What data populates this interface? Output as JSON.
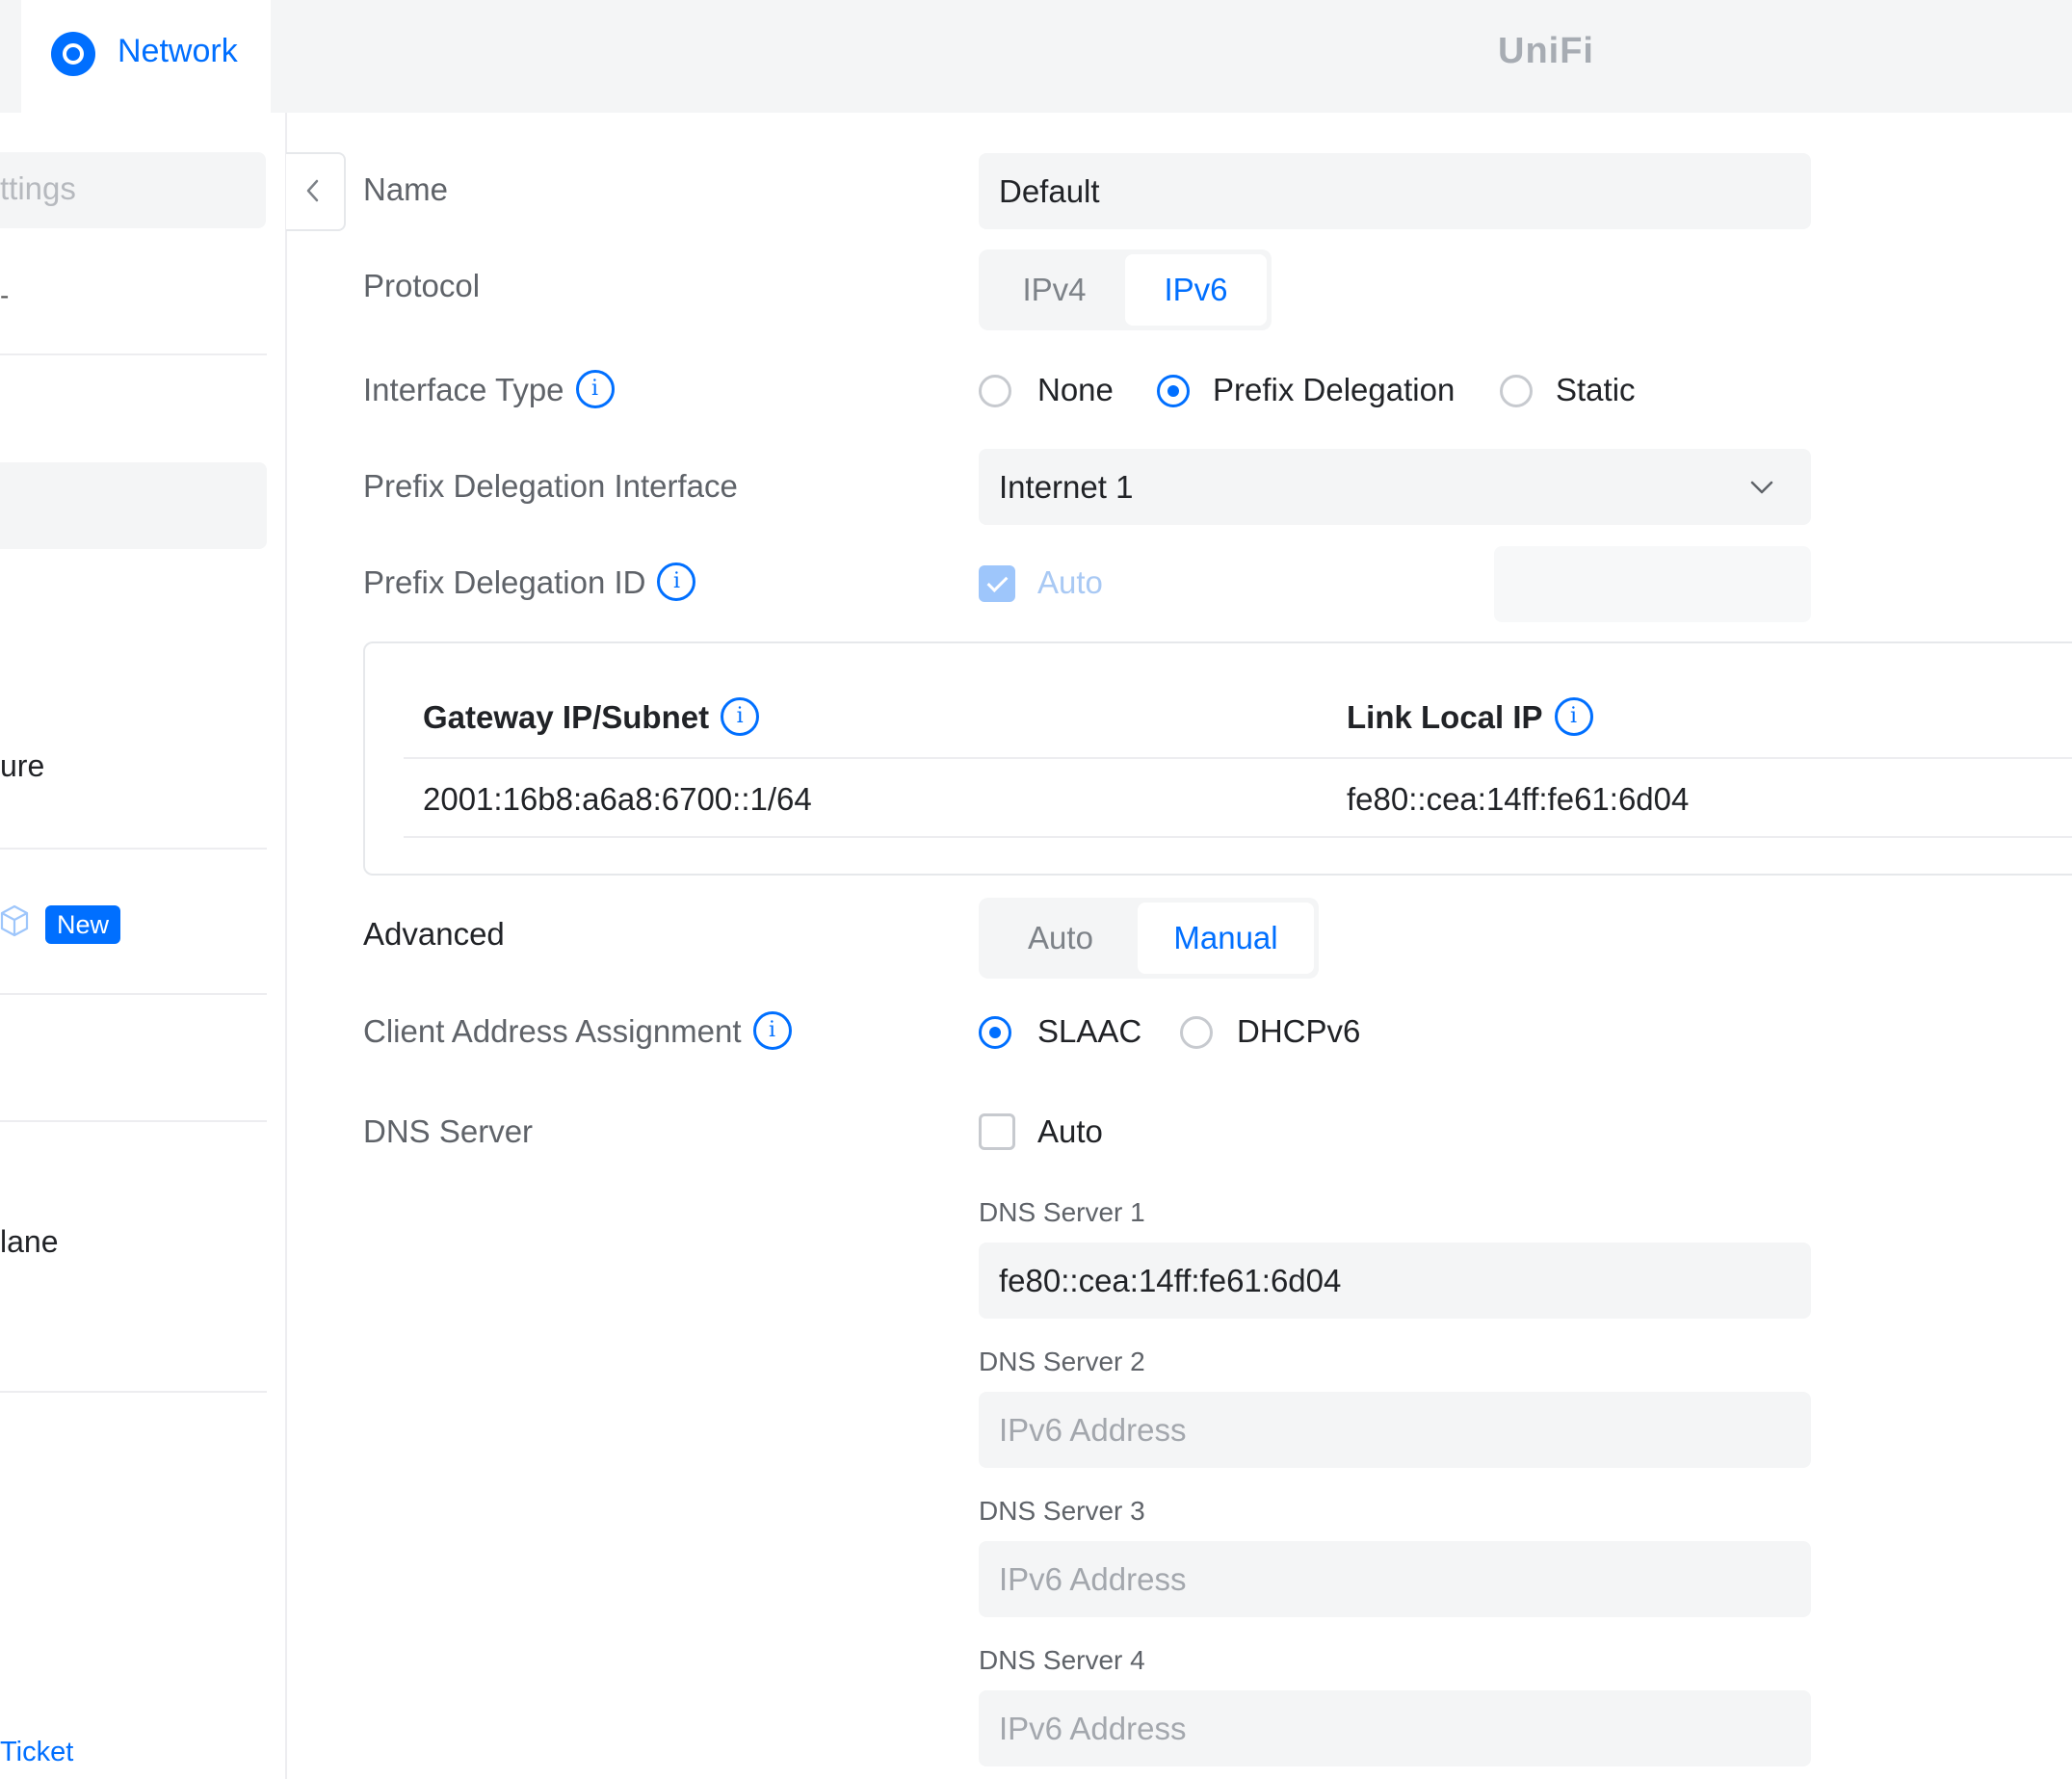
{
  "topbar": {
    "app_name": "Network",
    "brand": "UniFi"
  },
  "sidebar": {
    "search_fragment": "ttings",
    "dash": "-",
    "item_ure": "ure",
    "badge_new": "New",
    "item_lane": "lane",
    "ticket_link": "Ticket"
  },
  "form": {
    "name": {
      "label": "Name",
      "value": "Default"
    },
    "protocol": {
      "label": "Protocol",
      "options": [
        "IPv4",
        "IPv6"
      ],
      "selected": "IPv6"
    },
    "interface_type": {
      "label": "Interface Type",
      "options": [
        "None",
        "Prefix Delegation",
        "Static"
      ],
      "selected": "Prefix Delegation"
    },
    "pd_interface": {
      "label": "Prefix Delegation Interface",
      "value": "Internet 1"
    },
    "pd_id": {
      "label": "Prefix Delegation ID",
      "auto_label": "Auto",
      "auto_checked": true
    },
    "table": {
      "col1_header": "Gateway IP/Subnet",
      "col2_header": "Link Local IP",
      "col1_value": "2001:16b8:a6a8:6700::1/64",
      "col2_value": "fe80::cea:14ff:fe61:6d04"
    },
    "advanced": {
      "label": "Advanced",
      "options": [
        "Auto",
        "Manual"
      ],
      "selected": "Manual"
    },
    "client_assignment": {
      "label": "Client Address Assignment",
      "options": [
        "SLAAC",
        "DHCPv6"
      ],
      "selected": "SLAAC"
    },
    "dns": {
      "label": "DNS Server",
      "auto_label": "Auto",
      "auto_checked": false,
      "server1": {
        "label": "DNS Server 1",
        "value": "fe80::cea:14ff:fe61:6d04"
      },
      "server2": {
        "label": "DNS Server 2",
        "placeholder": "IPv6 Address"
      },
      "server3": {
        "label": "DNS Server 3",
        "placeholder": "IPv6 Address"
      },
      "server4": {
        "label": "DNS Server 4",
        "placeholder": "IPv6 Address"
      }
    }
  },
  "colors": {
    "accent": "#006fff",
    "field_bg": "#f4f5f6"
  }
}
